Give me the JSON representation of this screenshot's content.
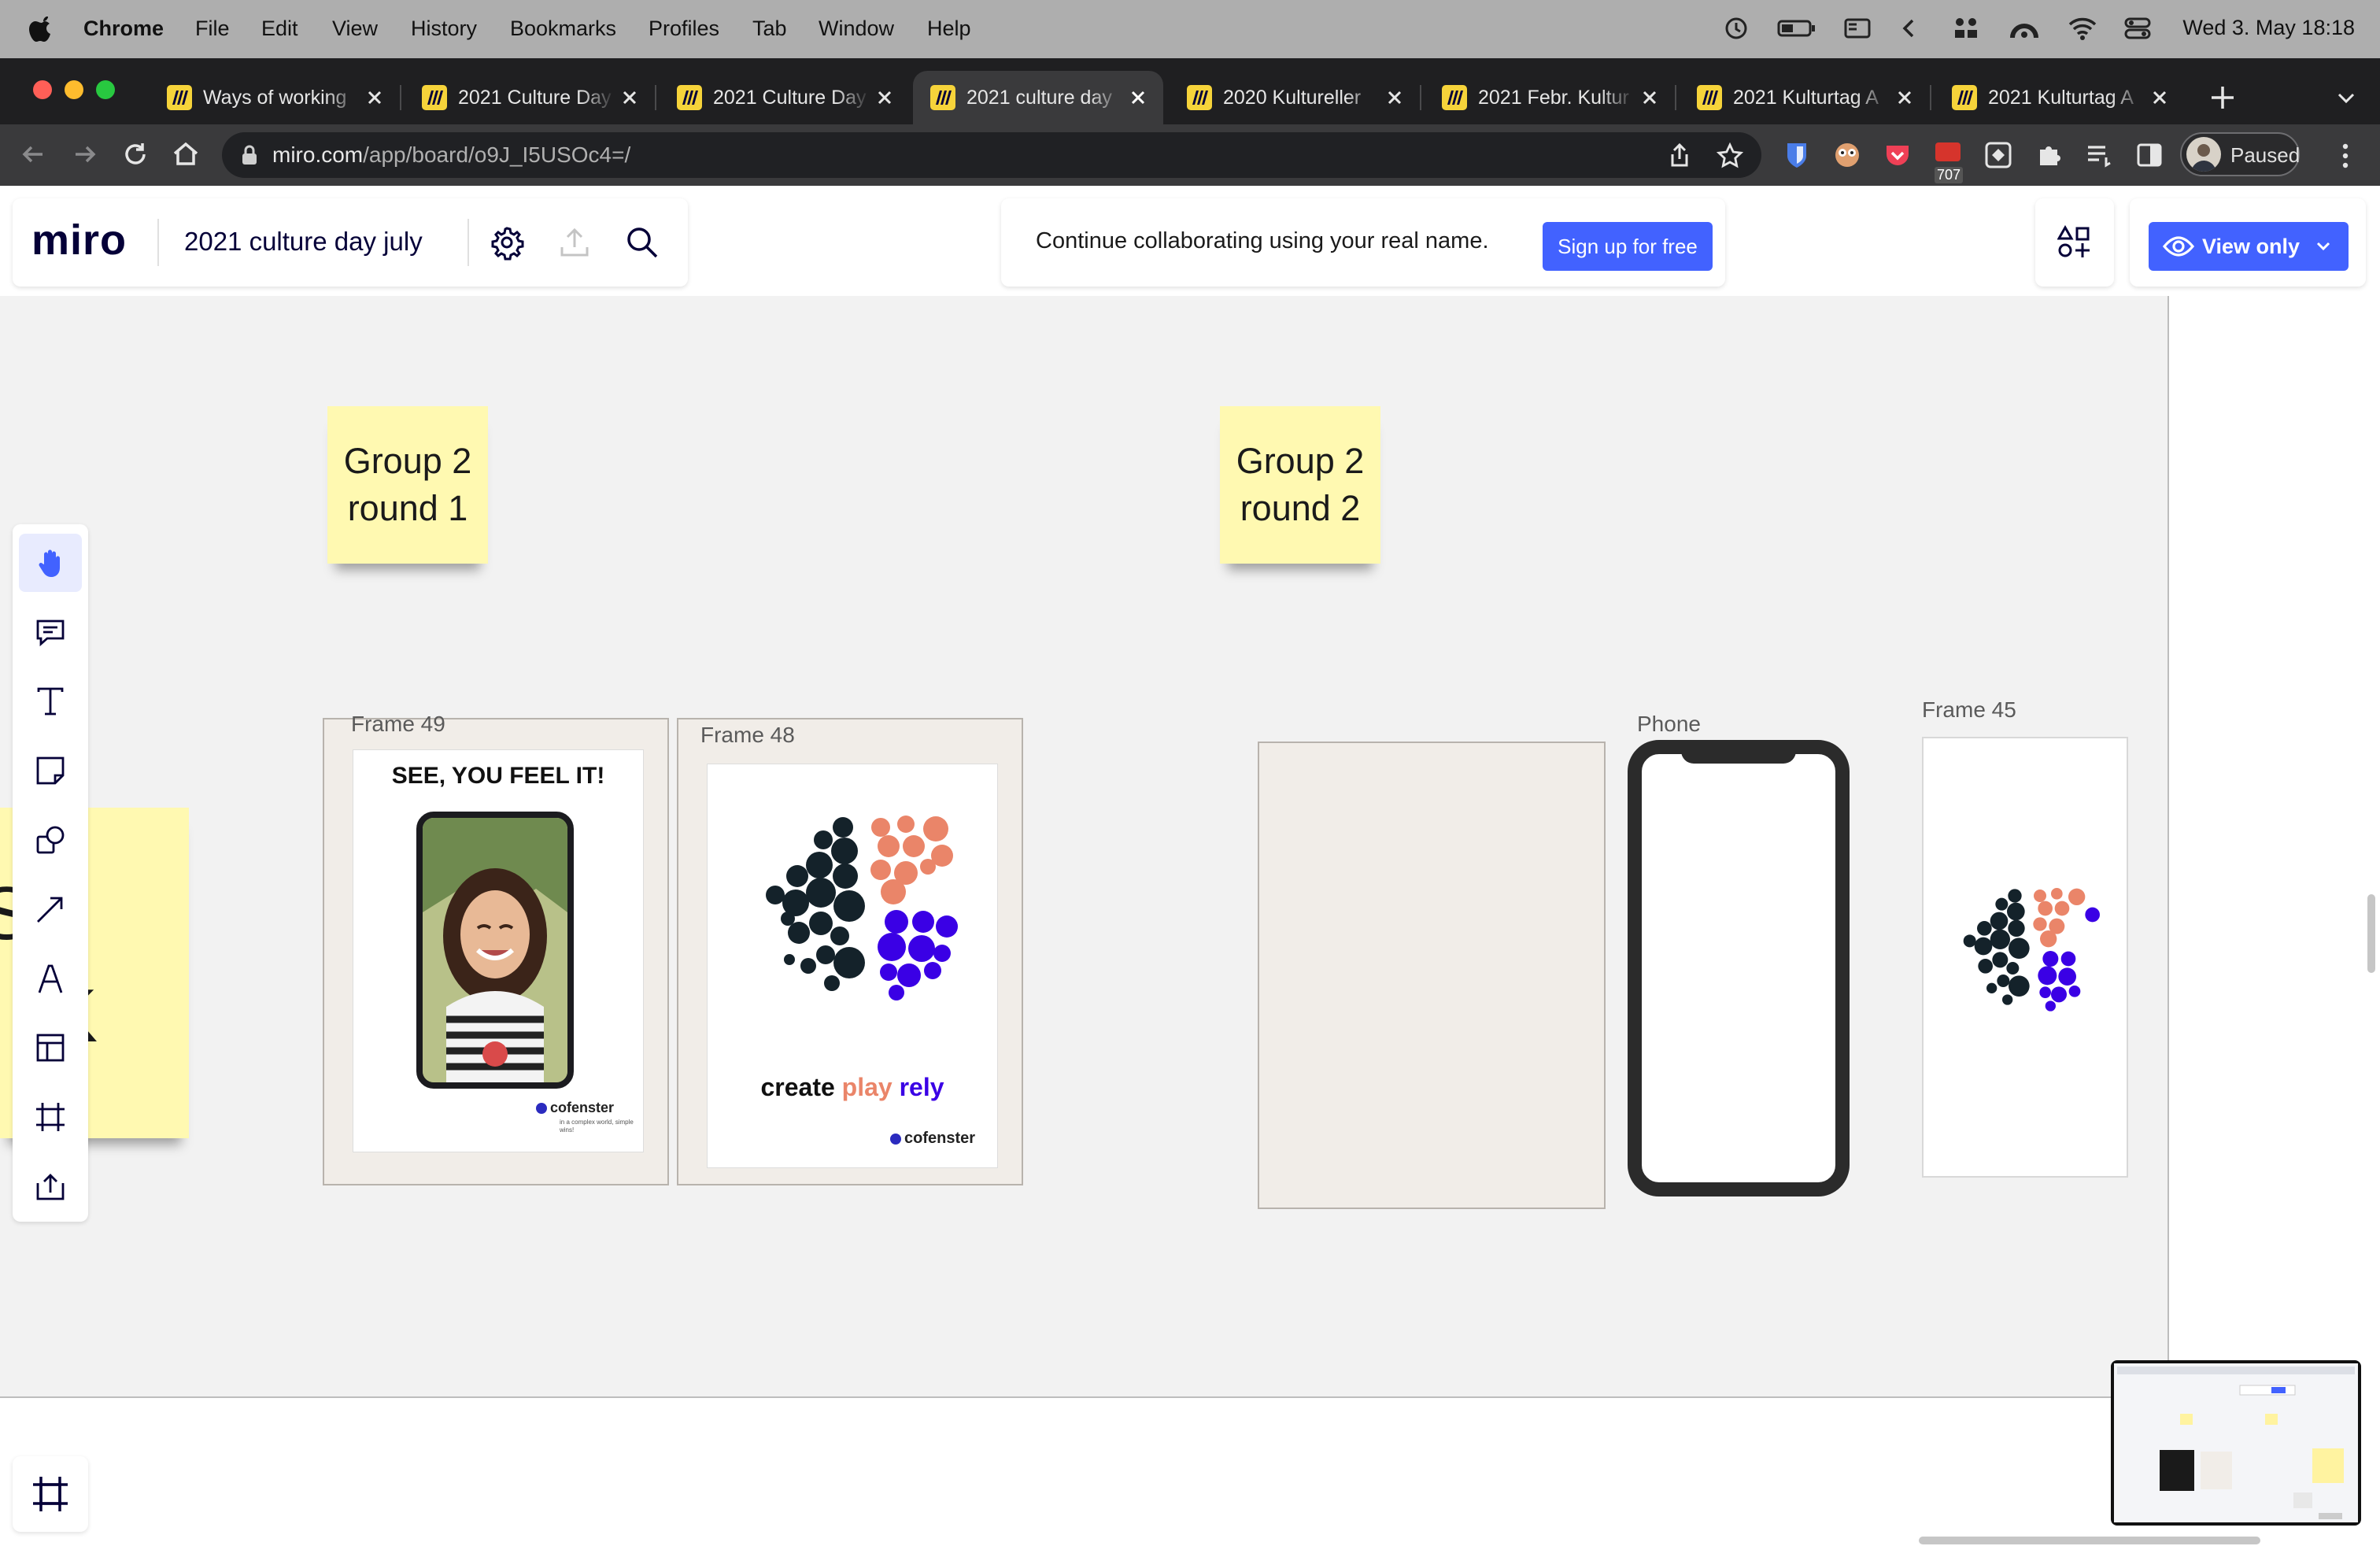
{
  "menubar": {
    "app": "Chrome",
    "items": [
      "File",
      "Edit",
      "View",
      "History",
      "Bookmarks",
      "Profiles",
      "Tab",
      "Window",
      "Help"
    ],
    "clock": "Wed 3. May  18:18"
  },
  "tabs": [
    {
      "title": "Ways of working",
      "active": false
    },
    {
      "title": "2021 Culture Day",
      "active": false
    },
    {
      "title": "2021 Culture Day",
      "active": false
    },
    {
      "title": "2021 culture day",
      "active": true
    },
    {
      "title": "2020 Kultureller",
      "active": false
    },
    {
      "title": "2021 Febr. Kultur",
      "active": false
    },
    {
      "title": "2021 Kulturtag A",
      "active": false
    },
    {
      "title": "2021 Kulturtag A",
      "active": false
    }
  ],
  "browser": {
    "url_host": "miro.com",
    "url_path": "/app/board/o9J_I5USOc4=/",
    "badge_count": "707",
    "profile_label": "Paused"
  },
  "miro": {
    "logo": "miro",
    "board_name": "2021 culture day july",
    "notice": "Continue collaborating using your real name.",
    "signup_label": "Sign up for free",
    "view_label": "View only",
    "accent": "#4262ff"
  },
  "canvas": {
    "stickies": [
      {
        "line1": "Group 2",
        "line2": "round 1"
      },
      {
        "line1": "Group 2",
        "line2": "round 2"
      }
    ],
    "partial_sticky": {
      "line1": "SE",
      "line2": "K"
    },
    "frames": {
      "f49": "Frame 49",
      "f48": "Frame 48",
      "phone": "Phone",
      "f45": "Frame 45"
    },
    "poster1": {
      "headline": "SEE, YOU FEEL IT!",
      "brand": "cofenster",
      "tagline": "in a complex world, simple wins!"
    },
    "poster2": {
      "w1": "create",
      "w2": "play",
      "w3": "rely",
      "brand": "cofenster"
    }
  }
}
